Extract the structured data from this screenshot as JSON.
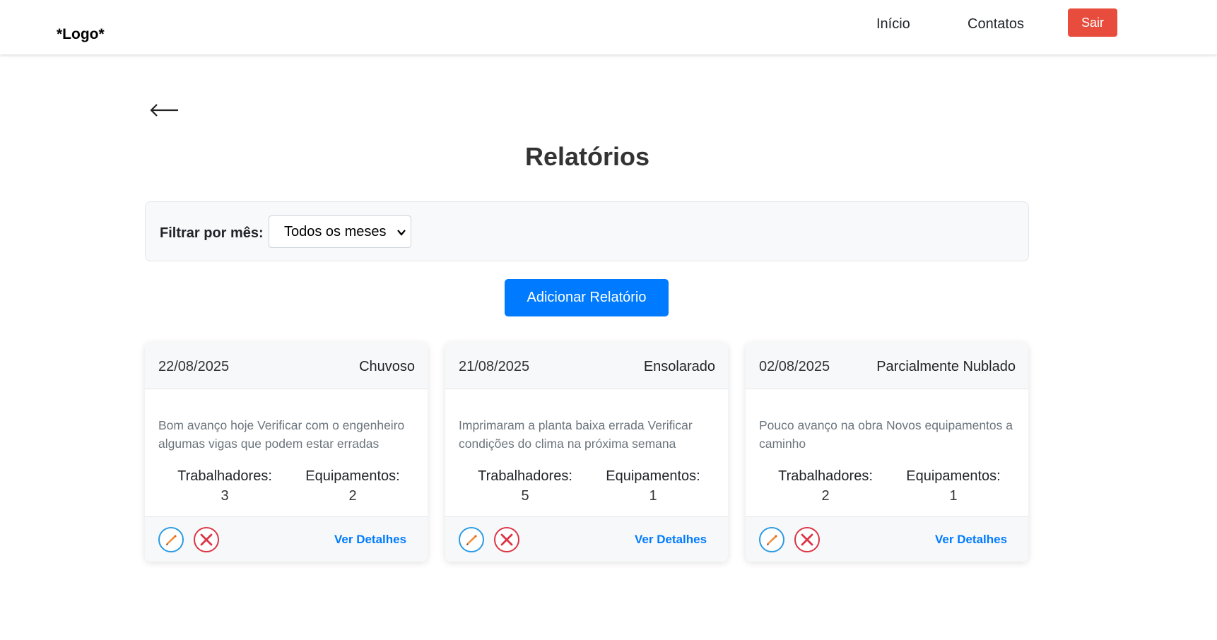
{
  "navbar": {
    "logo": "*Logo*",
    "links": [
      {
        "label": "Início"
      },
      {
        "label": "Contatos"
      }
    ],
    "logout_label": "Sair"
  },
  "page": {
    "back_icon": "arrow-left-icon",
    "title": "Relatórios"
  },
  "filter": {
    "label": "Filtrar por mês:",
    "selected": "Todos os meses"
  },
  "add_button_label": "Adicionar Relatório",
  "reports": [
    {
      "date": "22/08/2025",
      "weather": "Chuvoso",
      "description": "Bom avanço hoje Verificar com o engenheiro algumas vigas que podem estar erradas",
      "workers_label": "Trabalhadores:",
      "workers": "3",
      "equipment_label": "Equipamentos:",
      "equipment": "2",
      "details_label": "Ver Detalhes"
    },
    {
      "date": "21/08/2025",
      "weather": "Ensolarado",
      "description": "Imprimaram a planta baixa errada Verificar condições do clima na próxima semana",
      "workers_label": "Trabalhadores:",
      "workers": "5",
      "equipment_label": "Equipamentos:",
      "equipment": "1",
      "details_label": "Ver Detalhes"
    },
    {
      "date": "02/08/2025",
      "weather": "Parcialmente Nublado",
      "description": "Pouco avanço na obra Novos equipamentos a caminho",
      "workers_label": "Trabalhadores:",
      "workers": "2",
      "equipment_label": "Equipamentos:",
      "equipment": "1",
      "details_label": "Ver Detalhes"
    }
  ],
  "colors": {
    "primary": "#007bff",
    "logout": "#e74c3c",
    "edit_ring": "#2b9be2",
    "edit_pencil": "#f28c38",
    "delete": "#dc3545"
  }
}
